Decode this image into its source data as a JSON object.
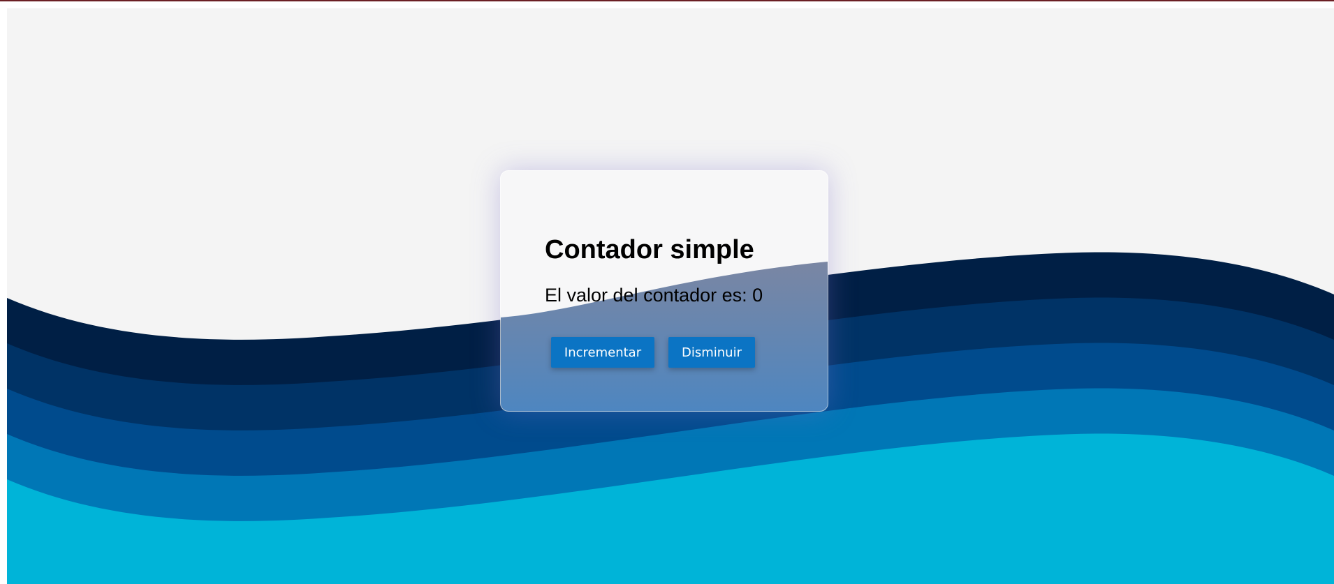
{
  "card": {
    "title": "Contador simple",
    "counter_label": "El valor del contador es: ",
    "counter_value": "0",
    "increment_label": "Incrementar",
    "decrement_label": "Disminuir"
  },
  "colors": {
    "page_background": "#f4f4f4",
    "wave_1": "#001f45",
    "wave_2": "#003366",
    "wave_3": "#004b8d",
    "wave_4": "#0077b6",
    "wave_5": "#00b4d8",
    "button": "#0b74c4",
    "top_border": "#6b1f24"
  }
}
